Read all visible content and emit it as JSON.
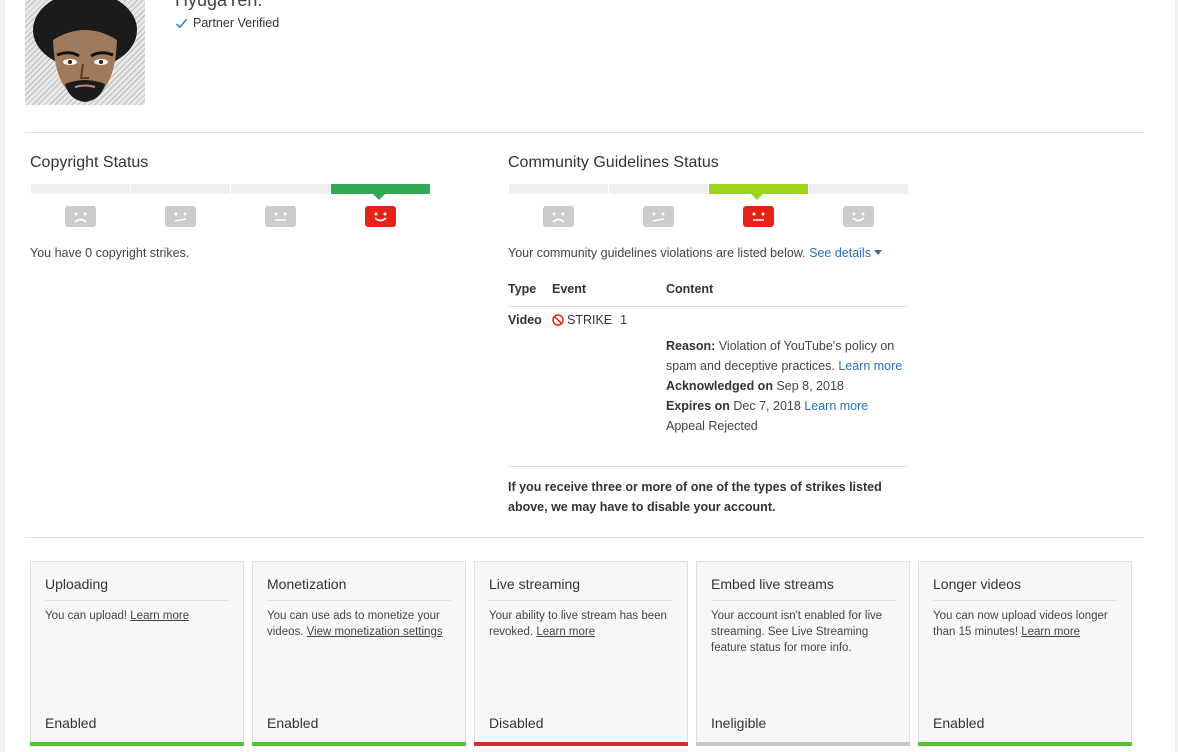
{
  "channel": {
    "name": "HyugaYeh.",
    "partner_label": "Partner Verified"
  },
  "copyright": {
    "title": "Copyright Status",
    "active_index": 3,
    "summary": "You have 0 copyright strikes."
  },
  "community": {
    "title": "Community Guidelines Status",
    "active_index": 2,
    "summary": "Your community guidelines violations are listed below.",
    "see_details": "See details",
    "table": {
      "headers": [
        "Type",
        "Event",
        "Content"
      ],
      "row": {
        "type": "Video",
        "event": "STRIKE",
        "count": "1"
      }
    },
    "detail": {
      "reason_label": "Reason:",
      "reason_text": "Violation of YouTube's policy on spam and deceptive practices.",
      "reason_link": "Learn more",
      "ack_label": "Acknowledged on",
      "ack_date": "Sep 8, 2018",
      "expires_label": "Expires on",
      "expires_date": "Dec 7, 2018",
      "expires_link": "Learn more",
      "appeal": "Appeal Rejected"
    },
    "warning": "If you receive three or more of one of the types of strikes listed above, we may have to disable your account."
  },
  "colors": {
    "green": "#34a853",
    "lime": "#9bd41d",
    "red": "#e62117",
    "enabled_bar": "#57c22a",
    "disabled_bar": "#d32f2f",
    "ineligible_bar": "#c8c8c8",
    "link": "#2f6fb3"
  },
  "features": [
    {
      "title": "Uploading",
      "desc": "You can upload!",
      "link": "Learn more",
      "status": "Enabled",
      "bar": "#57c22a"
    },
    {
      "title": "Monetization",
      "desc": "You can use ads to monetize your videos.",
      "link": "View monetization settings",
      "status": "Enabled",
      "bar": "#57c22a"
    },
    {
      "title": "Live streaming",
      "desc": "Your ability to live stream has been revoked.",
      "link": "Learn more",
      "status": "Disabled",
      "bar": "#d32f2f"
    },
    {
      "title": "Embed live streams",
      "desc": "Your account isn't enabled for live streaming. See Live Streaming feature status for more info.",
      "link": "",
      "status": "Ineligible",
      "bar": "#c8c8c8"
    },
    {
      "title": "Longer videos",
      "desc": "You can now upload videos longer than 15 minutes!",
      "link": "Learn more",
      "status": "Enabled",
      "bar": "#57c22a"
    }
  ]
}
